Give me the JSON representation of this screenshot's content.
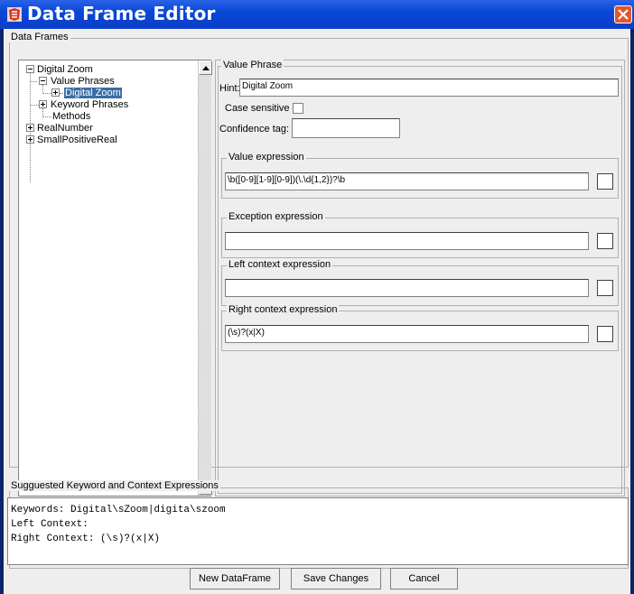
{
  "window": {
    "title": "Data Frame Editor"
  },
  "data_frames_group": {
    "label": "Data Frames"
  },
  "tree": {
    "nodes": [
      {
        "label": "Digital Zoom"
      },
      {
        "label": "Value Phrases"
      },
      {
        "label": "Digital Zoom"
      },
      {
        "label": "Keyword Phrases"
      },
      {
        "label": "Methods"
      },
      {
        "label": "RealNumber"
      },
      {
        "label": "SmallPositiveReal"
      }
    ]
  },
  "value_phrase": {
    "section_label": "Value Phrase",
    "hint_label": "Hint:",
    "hint_value": "Digital Zoom",
    "case_sensitive_label": "Case sensitive",
    "case_sensitive_checked": false,
    "confidence_tag_label": "Confidence tag:",
    "confidence_tag_value": "",
    "value_expression": {
      "label": "Value expression",
      "value": "\\b([0-9][1-9][0-9])(\\.\\d{1,2})?\\b"
    },
    "exception_expression": {
      "label": "Exception expression",
      "value": ""
    },
    "left_context_expression": {
      "label": "Left context expression",
      "value": ""
    },
    "right_context_expression": {
      "label": "Right context expression",
      "value": "(\\s)?(x|X)"
    }
  },
  "suggested": {
    "label": "Sugguested Keyword and Context Expressions",
    "lines": [
      "Keywords: Digital\\sZoom|digita\\szoom",
      "Left Context:",
      "Right Context: (\\s)?(x|X)"
    ]
  },
  "buttons": {
    "new_dataframe": "New DataFrame",
    "save_changes": "Save Changes",
    "cancel": "Cancel"
  },
  "colors": {
    "titlebar": "#0a47d6",
    "selection": "#3a6ea5",
    "panel_bg": "#eeeeee"
  }
}
